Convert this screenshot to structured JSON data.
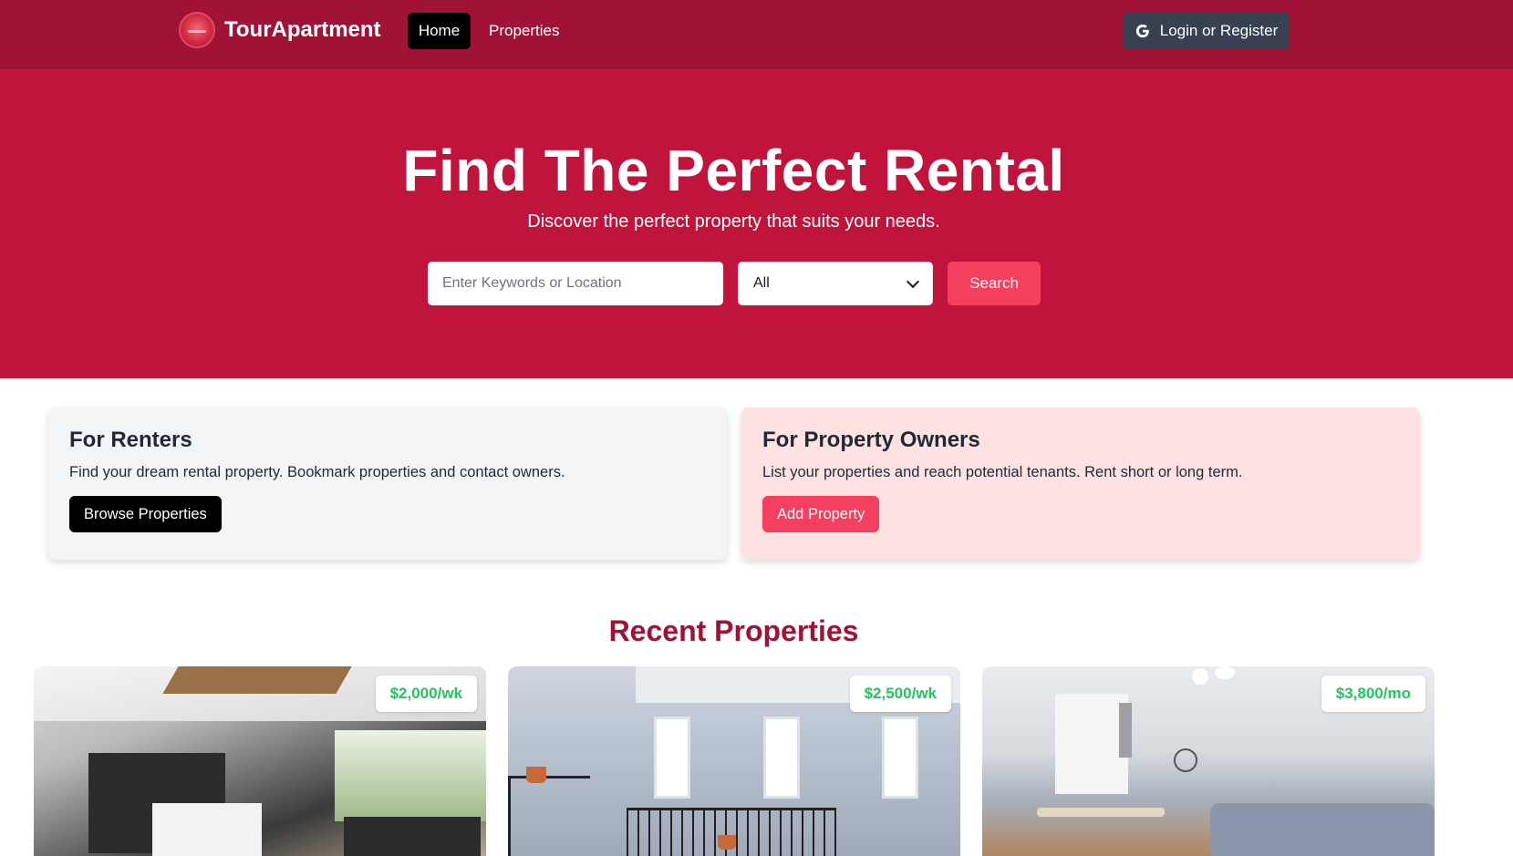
{
  "navbar": {
    "brand": "TourApartment",
    "links": [
      {
        "label": "Home",
        "active": true
      },
      {
        "label": "Properties",
        "active": false
      }
    ],
    "login_label": "Login or Register"
  },
  "hero": {
    "title": "Find The Perfect Rental",
    "subtitle": "Discover the perfect property that suits your needs.",
    "search_placeholder": "Enter Keywords or Location",
    "type_selected": "All",
    "search_button": "Search"
  },
  "cards": {
    "renters": {
      "title": "For Renters",
      "text": "Find your dream rental property. Bookmark properties and contact owners.",
      "button": "Browse Properties"
    },
    "owners": {
      "title": "For Property Owners",
      "text": "List your properties and reach potential tenants. Rent short or long term.",
      "button": "Add Property"
    }
  },
  "recent": {
    "title": "Recent Properties",
    "properties": [
      {
        "price": "$2,000/wk"
      },
      {
        "price": "$2,500/wk"
      },
      {
        "price": "$3,800/mo"
      }
    ]
  },
  "colors": {
    "navbar": "#a11237",
    "hero": "#c0143d",
    "accent": "#f43f5e",
    "price": "#22c55e",
    "heading": "#a11237"
  }
}
